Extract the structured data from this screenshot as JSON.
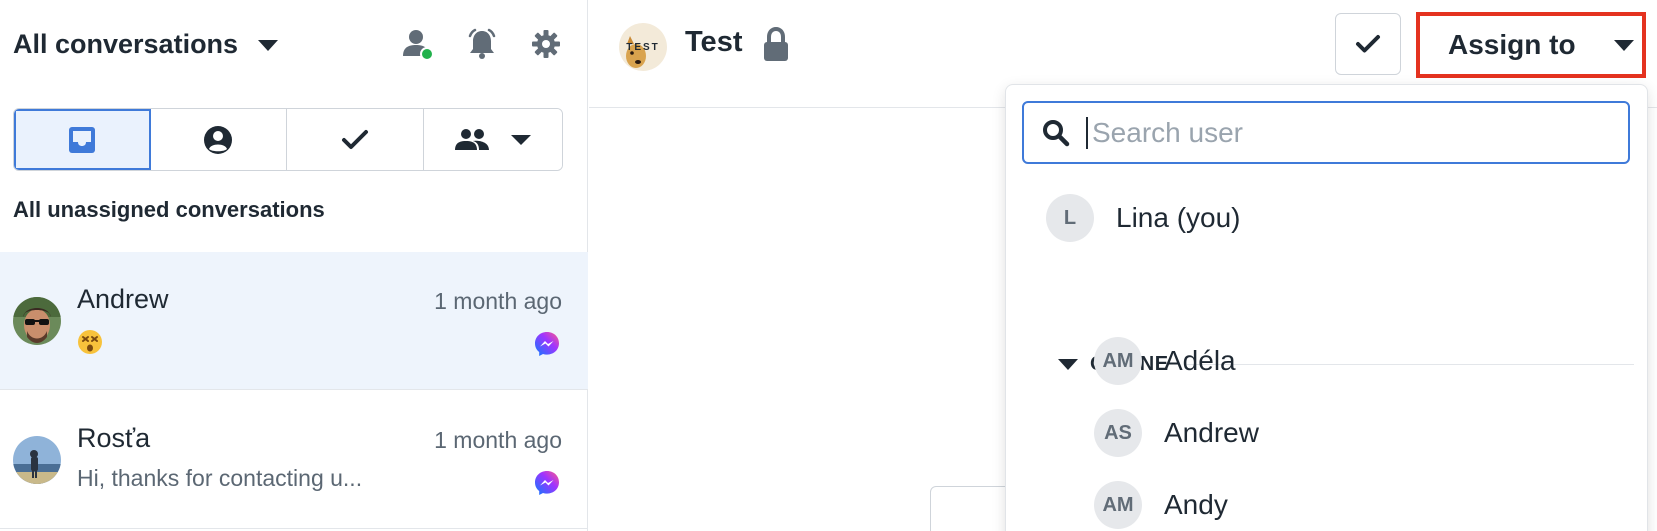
{
  "sidebar": {
    "title": "All conversations",
    "header_icons": [
      "user-status-icon",
      "bell-icon",
      "gear-icon"
    ],
    "filter_tabs": [
      {
        "name": "inbox-icon",
        "active": true
      },
      {
        "name": "user-circle-icon",
        "active": false
      },
      {
        "name": "check-icon",
        "active": false
      },
      {
        "name": "team-icon",
        "active": false
      }
    ],
    "subtitle": "All unassigned conversations",
    "conversations": [
      {
        "name": "Andrew",
        "time": "1 month ago",
        "preview": "😵",
        "channel": "messenger-icon",
        "selected": true
      },
      {
        "name": "Rosťa",
        "time": "1 month ago",
        "preview": "Hi, thanks for contacting u...",
        "channel": "messenger-icon",
        "selected": false
      }
    ]
  },
  "main": {
    "channel_logo_text": "TEST",
    "channel_title": "Test",
    "assign_label": "Assign to"
  },
  "assign_dropdown": {
    "search_placeholder": "Search user",
    "current_user": {
      "initials": "L",
      "name": "Lina (you)"
    },
    "group_label": "ONLINE",
    "users": [
      {
        "initials": "AM",
        "name": "Adéla"
      },
      {
        "initials": "AS",
        "name": "Andrew"
      },
      {
        "initials": "AM",
        "name": "Andy"
      }
    ]
  },
  "colors": {
    "accent": "#3f7ad9",
    "highlight_border": "#e4321f",
    "online_dot": "#22b14c",
    "selected_row": "#eef4fc"
  }
}
